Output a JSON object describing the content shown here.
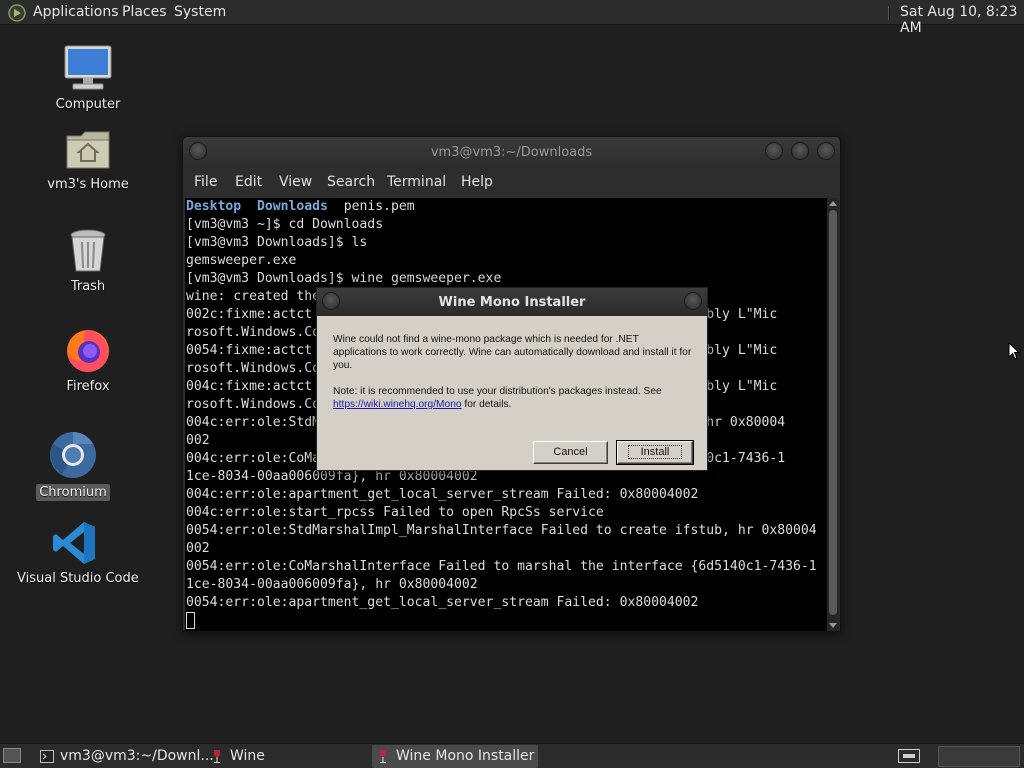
{
  "top_panel": {
    "applications": "Applications",
    "places": "Places",
    "system": "System",
    "clock": "Sat Aug 10,  8:23 AM"
  },
  "desktop_icons": {
    "computer": "Computer",
    "home": "vm3's Home",
    "trash": "Trash",
    "firefox": "Firefox",
    "chromium": "Chromium",
    "vscode": "Visual Studio Code"
  },
  "terminal": {
    "title": "vm3@vm3:~/Downloads",
    "menu": [
      "File",
      "Edit",
      "View",
      "Search",
      "Terminal",
      "Help"
    ],
    "ls_desktop": "Desktop",
    "ls_downloads": "Downloads",
    "ls_rest": "  penis.pem",
    "lines": [
      "[vm3@vm3 ~]$ cd Downloads",
      "[vm3@vm3 Downloads]$ ls",
      "gemsweeper.exe",
      "[vm3@vm3 Downloads]$ wine gemsweeper.exe",
      "wine: created the                                                             ",
      "002c:fixme:actct                                             assembly L\"Mic",
      "rosoft.Windows.Co",
      "0054:fixme:actct                                             assembly L\"Mic",
      "rosoft.Windows.Co",
      "004c:fixme:actct                                             assembly L\"Mic",
      "rosoft.Windows.Co",
      "004c:err:ole:StdM                                            tub, hr 0x80004",
      "002",
      "004c:err:ole:CoMa                                            6d5140c1-7436-1",
      "1ce-8034-00aa006009fa}, hr 0x80004002",
      "004c:err:ole:apartment_get_local_server_stream Failed: 0x80004002",
      "004c:err:ole:start_rpcss Failed to open RpcSs service",
      "0054:err:ole:StdMarshalImpl_MarshalInterface Failed to create ifstub, hr 0x80004",
      "002",
      "0054:err:ole:CoMarshalInterface Failed to marshal the interface {6d5140c1-7436-1",
      "1ce-8034-00aa006009fa}, hr 0x80004002",
      "0054:err:ole:apartment_get_local_server_stream Failed: 0x80004002"
    ]
  },
  "dialog": {
    "title": "Wine Mono Installer",
    "paragraph1": "Wine could not find a wine-mono package which is needed for .NET applications to work correctly. Wine can automatically download and install it for you.",
    "note_prefix": "Note: it is recommended to use your distribution's packages instead. See ",
    "link": "https://wiki.winehq.org/Mono",
    "note_suffix": " for details.",
    "cancel": "Cancel",
    "install": "Install"
  },
  "taskbar": {
    "terminal_task": "vm3@vm3:~/Downl...",
    "wine_task": "Wine",
    "mono_task": "Wine Mono Installer"
  }
}
